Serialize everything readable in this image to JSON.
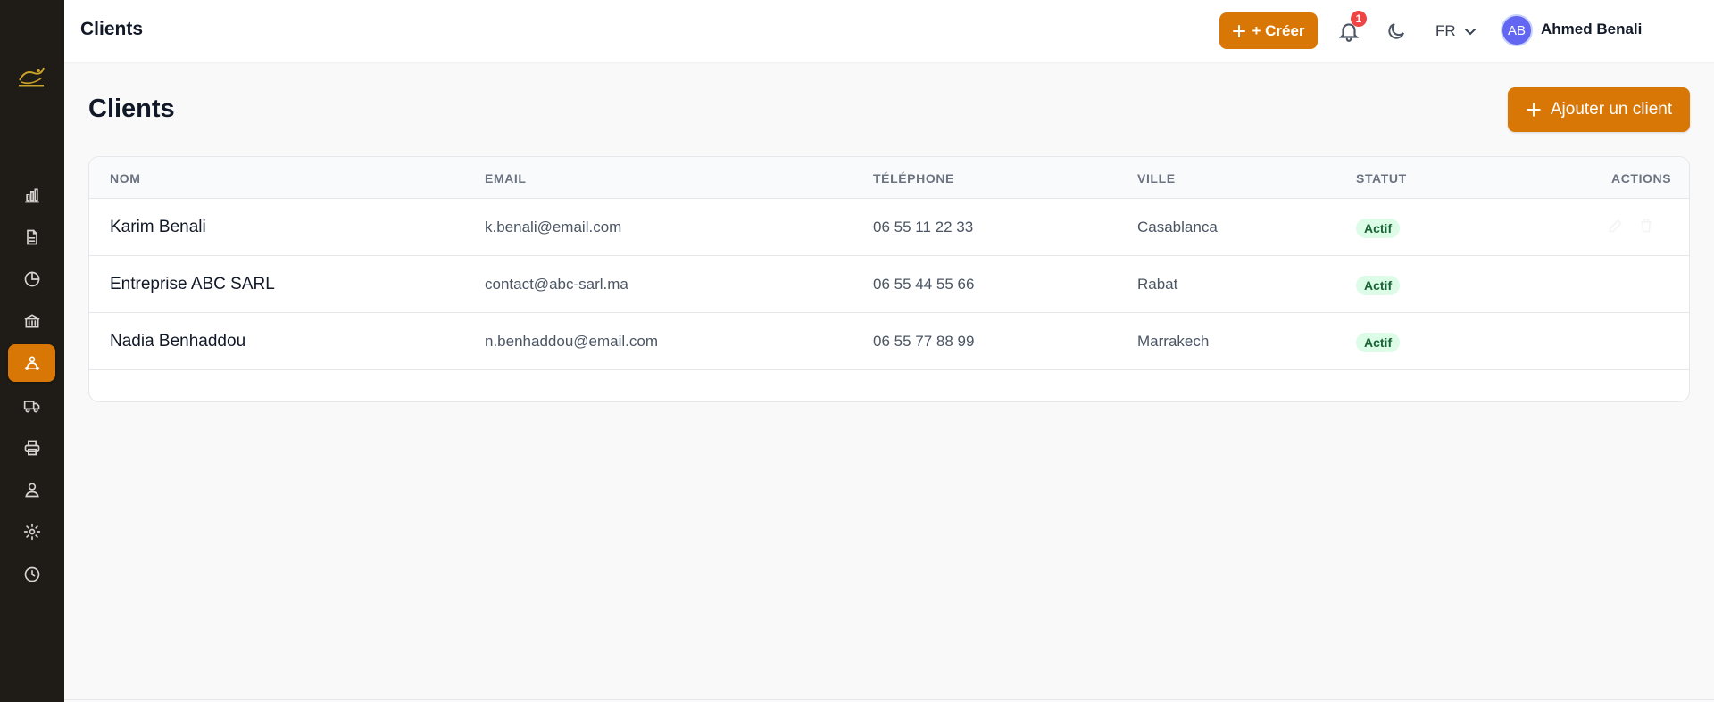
{
  "header": {
    "title": "Clients",
    "create_label": "+ Créer",
    "notification_count": "1",
    "language": "FR",
    "avatar_initials": "AB",
    "user_name": "Ahmed Benali"
  },
  "sidebar": {
    "active_index": 4,
    "items": [
      {
        "icon": "bar-chart-icon"
      },
      {
        "icon": "document-icon"
      },
      {
        "icon": "pie-chart-icon"
      },
      {
        "icon": "bank-icon"
      },
      {
        "icon": "clients-icon"
      },
      {
        "icon": "truck-icon"
      },
      {
        "icon": "printer-icon"
      },
      {
        "icon": "users-icon"
      },
      {
        "icon": "settings-icon"
      },
      {
        "icon": "clock-icon"
      }
    ]
  },
  "main": {
    "page_title": "Clients",
    "add_button_label": "Ajouter un client",
    "table": {
      "columns": {
        "name": "NOM",
        "email": "EMAIL",
        "phone": "TÉLÉPHONE",
        "city": "VILLE",
        "status": "STATUT",
        "actions": "ACTIONS"
      },
      "rows": [
        {
          "name": "Karim Benali",
          "email": "k.benali@email.com",
          "phone": "06 55 11 22 33",
          "city": "Casablanca",
          "status": "Actif"
        },
        {
          "name": "Entreprise ABC SARL",
          "email": "contact@abc-sarl.ma",
          "phone": "06 55 44 55 66",
          "city": "Rabat",
          "status": "Actif"
        },
        {
          "name": "Nadia Benhaddou",
          "email": "n.benhaddou@email.com",
          "phone": "06 55 77 88 99",
          "city": "Marrakech",
          "status": "Actif"
        }
      ]
    }
  },
  "colors": {
    "accent": "#d97706",
    "sidebar_bg": "#1f1b17",
    "status_bg": "#dcfce7",
    "status_text": "#166534",
    "badge_red": "#ef4444",
    "avatar": "#6366f1"
  }
}
